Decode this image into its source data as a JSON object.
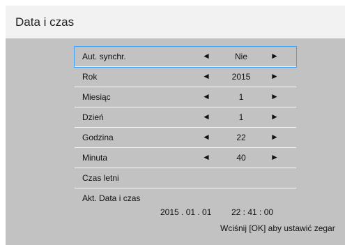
{
  "title": "Data i czas",
  "menu": [
    {
      "label": "Aut. synchr.",
      "value": "Nie"
    },
    {
      "label": "Rok",
      "value": "2015"
    },
    {
      "label": "Miesiąc",
      "value": "1"
    },
    {
      "label": "Dzień",
      "value": "1"
    },
    {
      "label": "Godzina",
      "value": "22"
    },
    {
      "label": "Minuta",
      "value": "40"
    },
    {
      "label": "Czas letni"
    }
  ],
  "current": {
    "label": "Akt. Data i czas",
    "date": "2015 . 01 . 01",
    "time": "22 : 41 : 00"
  },
  "arrows": {
    "left": "◄",
    "right": "►"
  },
  "hint": "Wciśnij [OK] aby ustawić zegar",
  "colors": {
    "background": "#c2c2c2",
    "titlebar": "#f2f2f2",
    "selection": "#3ea2ff"
  }
}
